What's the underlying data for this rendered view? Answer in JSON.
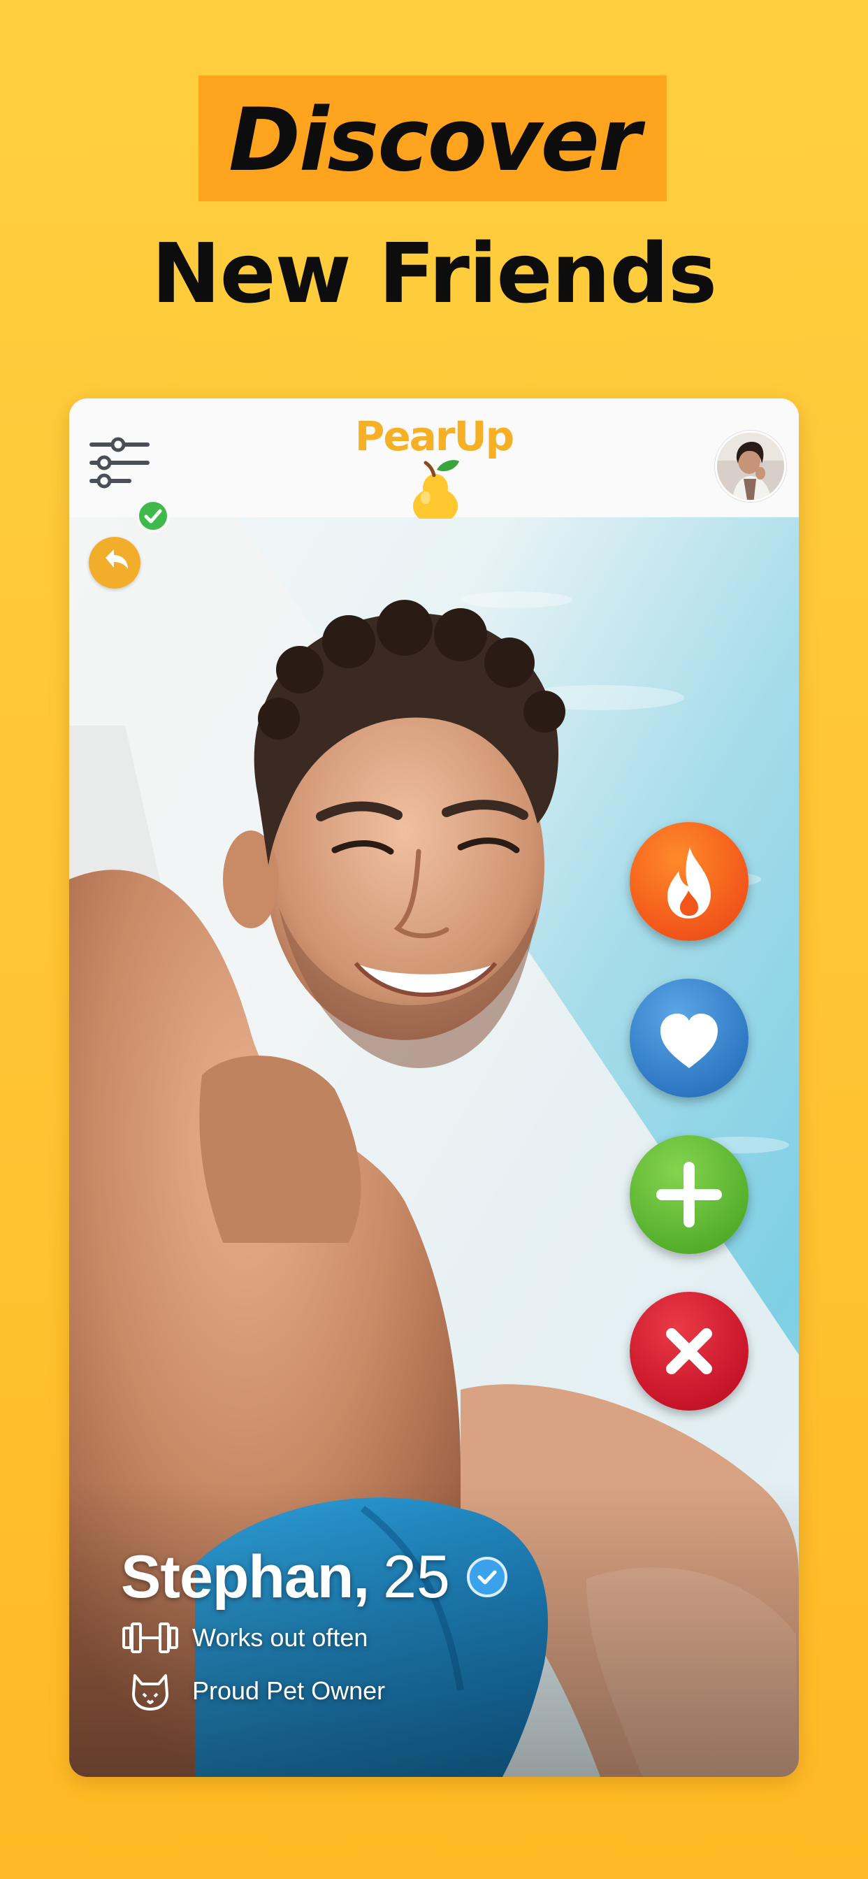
{
  "headline": {
    "line1": "Discover",
    "line2": "New Friends"
  },
  "app": {
    "logo_text": "PearUp"
  },
  "profile": {
    "name": "Stephan,",
    "age": "25",
    "tags": [
      {
        "label": "Works out often",
        "icon": "dumbbell-icon"
      },
      {
        "label": "Proud Pet Owner",
        "icon": "cat-icon"
      }
    ]
  },
  "actions": [
    {
      "name": "super-like",
      "icon": "flame-icon",
      "color": "#f2561a"
    },
    {
      "name": "like",
      "icon": "heart-icon",
      "color": "#2f78c4"
    },
    {
      "name": "add-friend",
      "icon": "plus-icon",
      "color": "#56b02c"
    },
    {
      "name": "pass",
      "icon": "close-icon",
      "color": "#c8152a"
    }
  ],
  "colors": {
    "background": "#ffc332",
    "highlight": "#ffa41f",
    "logo": "#f5b025",
    "undo": "#f2ae2b",
    "verified": "#3aa2ea"
  }
}
